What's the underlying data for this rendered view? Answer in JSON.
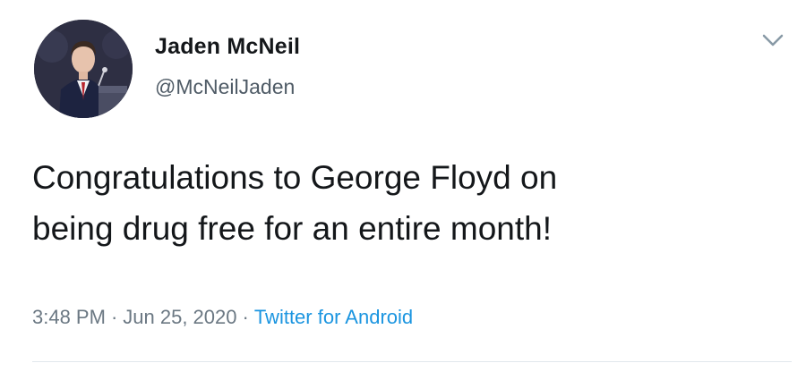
{
  "tweet": {
    "author": {
      "display_name": "Jaden McNeil",
      "handle": "@McNeilJaden",
      "avatar_icon": "profile-photo"
    },
    "menu_icon": "chevron-down-icon",
    "text_lines": [
      "Congratulations to George Floyd on",
      "being drug free for an entire month!"
    ],
    "meta": {
      "time": "3:48 PM",
      "separator": "·",
      "date": "Jun 25, 2020",
      "source": "Twitter for Android"
    }
  },
  "colors": {
    "text": "#14171a",
    "secondary_text": "#6b7883",
    "link": "#1b95e0",
    "divider": "#e1e8ed"
  }
}
